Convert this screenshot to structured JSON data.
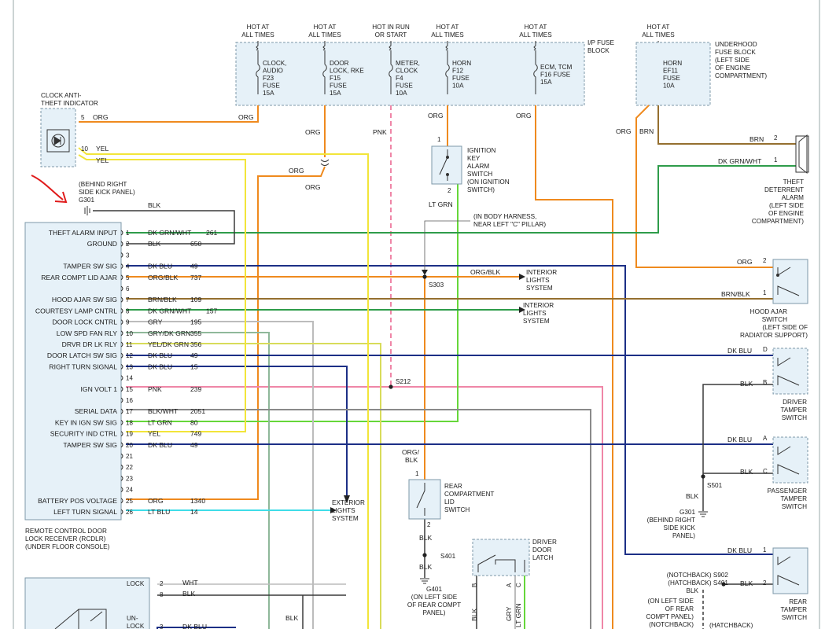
{
  "fuse_block": {
    "label": [
      "I/P FUSE",
      "BLOCK"
    ],
    "headers": [
      [
        "HOT AT",
        "ALL TIMES"
      ],
      [
        "HOT AT",
        "ALL TIMES"
      ],
      [
        "HOT IN RUN",
        "OR START"
      ],
      [
        "HOT AT",
        "ALL TIMES"
      ],
      [
        "HOT AT",
        "ALL TIMES"
      ]
    ],
    "fuses": [
      [
        "CLOCK,",
        "AUDIO",
        "F23",
        "FUSE",
        "15A"
      ],
      [
        "DOOR",
        "LOCK, RKE",
        "F15",
        "FUSE",
        "15A"
      ],
      [
        "METER,",
        "CLOCK",
        "F4",
        "FUSE",
        "10A"
      ],
      [
        "HORN",
        "F12",
        "FUSE",
        "10A"
      ],
      [
        "ECM, TCM",
        "F16 FUSE",
        "15A"
      ]
    ]
  },
  "underhood_block": {
    "header": [
      "HOT AT",
      "ALL TIMES"
    ],
    "fuse": [
      "HORN",
      "EF11",
      "FUSE",
      "10A"
    ],
    "label": [
      "UNDERHOOD",
      "FUSE BLOCK",
      "(LEFT SIDE",
      "OF ENGINE",
      "COMPARTMENT)"
    ]
  },
  "clock_indicator": {
    "label": [
      "CLOCK ANTI-",
      "THEFT INDICATOR"
    ],
    "pin5": "5",
    "pin10": "10",
    "w5": "ORG",
    "w5b": "ORG",
    "w10": "YEL",
    "w10b": "YEL"
  },
  "ground_g301": {
    "label": [
      "(BEHIND RIGHT",
      "SIDE KICK PANEL)",
      "G301"
    ],
    "wire": "BLK"
  },
  "wire_labels": {
    "org1": "ORG",
    "org2": "ORG",
    "org3": "ORG",
    "pnk": "PNK",
    "org4": "ORG",
    "org5": "ORG",
    "ltgrn_sw": "LT GRN",
    "pin1": "1",
    "pin2": "2",
    "brn_uh": "BRN",
    "org_uh": "ORG",
    "s303": "S303",
    "s212": "S212",
    "orgblk_s303": "ORG/BLK",
    "body_harness": [
      "(IN BODY HARNESS,",
      "NEAR LEFT \"C\" PILLAR)"
    ],
    "orgblk_rear": [
      "ORG/",
      "BLK"
    ]
  },
  "ignition_switch": {
    "label": [
      "IGNITION",
      "KEY",
      "ALARM",
      "SWITCH",
      "(ON IGNITION",
      "SWITCH)"
    ]
  },
  "rcdlr": {
    "title": [
      "REMOTE CONTROL DOOR",
      "LOCK RECEIVER (RCDLR)",
      "(UNDER FLOOR CONSOLE)"
    ],
    "pins": [
      {
        "n": "1",
        "func": "THEFT ALARM INPUT",
        "color": "DK GRN/WHT",
        "circuit": "261"
      },
      {
        "n": "2",
        "func": "GROUND",
        "color": "BLK",
        "circuit": "650"
      },
      {
        "n": "3",
        "func": "",
        "color": "",
        "circuit": ""
      },
      {
        "n": "4",
        "func": "TAMPER SW SIG",
        "color": "DK BLU",
        "circuit": "49"
      },
      {
        "n": "5",
        "func": "REAR COMPT LID AJAR",
        "color": "ORG/BLK",
        "circuit": "737"
      },
      {
        "n": "6",
        "func": "",
        "color": "",
        "circuit": ""
      },
      {
        "n": "7",
        "func": "HOOD AJAR SW SIG",
        "color": "BRN/BLK",
        "circuit": "109"
      },
      {
        "n": "8",
        "func": "COURTESY LAMP CNTRL",
        "color": "DK GRN/WHT",
        "circuit": "157"
      },
      {
        "n": "9",
        "func": "DOOR LOCK CNTRL",
        "color": "GRY",
        "circuit": "195"
      },
      {
        "n": "10",
        "func": "LOW SPD FAN RLY",
        "color": "GRY/DK GRN",
        "circuit": "355"
      },
      {
        "n": "11",
        "func": "DRVR DR LK RLY",
        "color": "YEL/DK GRN",
        "circuit": "356"
      },
      {
        "n": "12",
        "func": "DOOR LATCH SW SIG",
        "color": "DK BLU",
        "circuit": "49"
      },
      {
        "n": "13",
        "func": "RIGHT TURN SIGNAL",
        "color": "DK BLU",
        "circuit": "15"
      },
      {
        "n": "14",
        "func": "",
        "color": "",
        "circuit": ""
      },
      {
        "n": "15",
        "func": "IGN VOLT 1",
        "color": "PNK",
        "circuit": "239"
      },
      {
        "n": "16",
        "func": "",
        "color": "",
        "circuit": ""
      },
      {
        "n": "17",
        "func": "SERIAL DATA",
        "color": "BLK/WHT",
        "circuit": "2051"
      },
      {
        "n": "18",
        "func": "KEY IN IGN SW SIG",
        "color": "LT GRN",
        "circuit": "80"
      },
      {
        "n": "19",
        "func": "SECURITY IND CTRL",
        "color": "YEL",
        "circuit": "749"
      },
      {
        "n": "20",
        "func": "TAMPER SW SIG",
        "color": "DK BLU",
        "circuit": "49"
      },
      {
        "n": "21",
        "func": "",
        "color": "",
        "circuit": ""
      },
      {
        "n": "22",
        "func": "",
        "color": "",
        "circuit": ""
      },
      {
        "n": "23",
        "func": "",
        "color": "",
        "circuit": ""
      },
      {
        "n": "24",
        "func": "",
        "color": "",
        "circuit": ""
      },
      {
        "n": "25",
        "func": "BATTERY POS VOLTAGE",
        "color": "ORG",
        "circuit": "1340"
      },
      {
        "n": "26",
        "func": "LEFT TURN SIGNAL",
        "color": "LT BLU",
        "circuit": "14"
      }
    ]
  },
  "destinations": {
    "interior1": [
      "INTERIOR",
      "LIGHTS",
      "SYSTEM"
    ],
    "interior2": [
      "INTERIOR",
      "LIGHTS",
      "SYSTEM"
    ],
    "exterior": [
      "EXTERIOR",
      "LIGHTS",
      "SYSTEM"
    ]
  },
  "alarm": {
    "label": [
      "THEFT",
      "DETERRENT",
      "ALARM",
      "(LEFT SIDE",
      "OF ENGINE",
      "COMPARTMENT)"
    ],
    "w2": "BRN",
    "w1": "DK GRN/WHT",
    "p2": "2",
    "p1": "1"
  },
  "hood_switch": {
    "label": [
      "HOOD AJAR",
      "SWITCH",
      "(LEFT SIDE OF",
      "RADIATOR SUPPORT)"
    ],
    "w2": "ORG",
    "w1": "BRN/BLK",
    "p2": "2",
    "p1": "1"
  },
  "driver_tamper": {
    "label": [
      "DRIVER",
      "TAMPER",
      "SWITCH"
    ],
    "wD": "DK BLU",
    "wB": "BLK",
    "pD": "D",
    "pB": "B"
  },
  "pass_tamper": {
    "label": [
      "PASSENGER",
      "TAMPER",
      "SWITCH"
    ],
    "wA": "DK BLU",
    "wC": "BLK",
    "pA": "A",
    "pC": "C"
  },
  "s501": {
    "splice": "S501",
    "blk": "BLK",
    "g301": [
      "G301",
      "(BEHIND RIGHT",
      "SIDE KICK",
      "PANEL)"
    ]
  },
  "rear_lid": {
    "label": [
      "REAR",
      "COMPARTMENT",
      "LID",
      "SWITCH"
    ],
    "p1": "1",
    "p2": "2",
    "blk1": "BLK",
    "s401": "S401",
    "blk2": "BLK",
    "g401": [
      "G401",
      "(ON LEFT SIDE",
      "OF REAR COMPT",
      "PANEL)"
    ]
  },
  "door_latch": {
    "label": [
      "DRIVER",
      "DOOR",
      "LATCH"
    ],
    "pins": [
      "B",
      "A",
      "C"
    ],
    "wires": [
      "BLK",
      "GRY",
      "LT GRN"
    ]
  },
  "rear_tamper": {
    "label": [
      "REAR",
      "TAMPER",
      "SWITCH"
    ],
    "w1": "DK BLU",
    "w2": "BLK",
    "p1": "1",
    "p2": "2",
    "notch": [
      "(NOTCHBACK) S902",
      "(HATCHBACK) S401",
      "BLK"
    ],
    "left": [
      "(ON LEFT SIDE",
      "OF REAR",
      "COMPT PANEL)",
      "(NOTCHBACK)"
    ],
    "hatch": "(HATCHBACK)"
  },
  "lock_switch": {
    "lock": "LOCK",
    "unlock": [
      "UN-",
      "LOCK"
    ],
    "p2": "2",
    "p8": "8",
    "p3": "3",
    "w2": "WHT",
    "w8": "BLK",
    "w3": "DK BLU",
    "blk": "BLK"
  },
  "colors": {
    "org": "#ef8a1e",
    "yel": "#f2e53a",
    "pnk": "#ef86a7",
    "ltgrn": "#66d73a",
    "dkgrn": "#2e9c4a",
    "dkblu": "#1c2f86",
    "brn": "#956f2f",
    "gry": "#bcbcbc",
    "blk": "#3a3a3a",
    "ltblu": "#3fdde8",
    "box_fill": "#e6f1f8",
    "box_stroke": "#7d98a8"
  }
}
